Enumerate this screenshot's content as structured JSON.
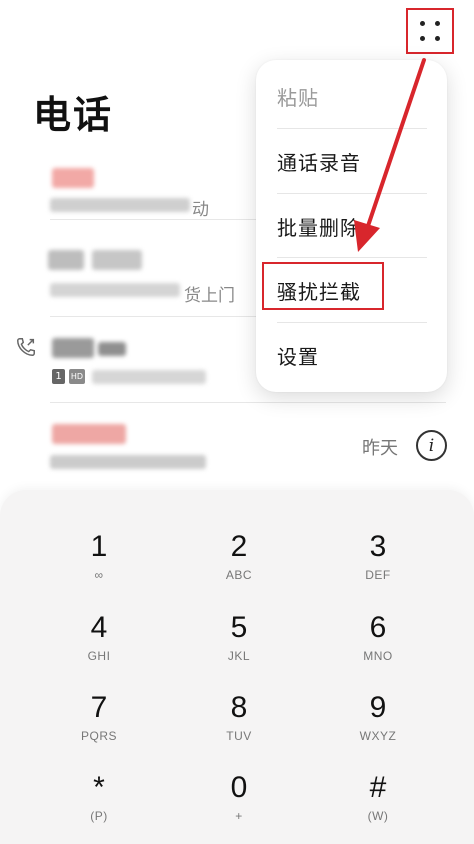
{
  "header": {
    "title": "电话",
    "more_icon": "more-dots-icon"
  },
  "call_log": {
    "partial_text_1": "货上门",
    "partial_text_2": "动",
    "row_time": "昨天",
    "sim_badge": "1",
    "hd_badge": "HD"
  },
  "menu": {
    "items": [
      {
        "label": "粘贴",
        "state": "disabled"
      },
      {
        "label": "通话录音"
      },
      {
        "label": "批量删除"
      },
      {
        "label": "骚扰拦截",
        "highlighted": true
      },
      {
        "label": "设置"
      }
    ]
  },
  "dialpad": {
    "keys": [
      {
        "digit": "1",
        "letters": "∞"
      },
      {
        "digit": "2",
        "letters": "ABC"
      },
      {
        "digit": "3",
        "letters": "DEF"
      },
      {
        "digit": "4",
        "letters": "GHI"
      },
      {
        "digit": "5",
        "letters": "JKL"
      },
      {
        "digit": "6",
        "letters": "MNO"
      },
      {
        "digit": "7",
        "letters": "PQRS"
      },
      {
        "digit": "8",
        "letters": "TUV"
      },
      {
        "digit": "9",
        "letters": "WXYZ"
      },
      {
        "digit": "*",
        "letters": "(P)"
      },
      {
        "digit": "0",
        "letters": "+"
      },
      {
        "digit": "#",
        "letters": "(W)"
      }
    ]
  },
  "colors": {
    "annotation_red": "#d8262c",
    "dialpad_bg": "#f5f4f4"
  }
}
